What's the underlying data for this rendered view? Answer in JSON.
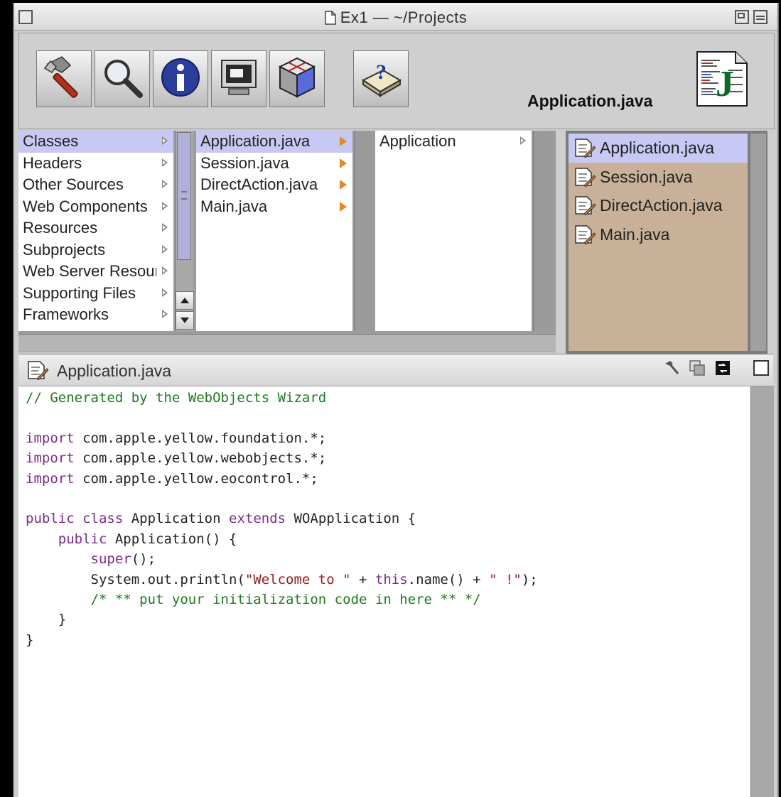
{
  "window": {
    "title": "Ex1 — ~/Projects"
  },
  "toolbar": {
    "buttons": [
      {
        "name": "build-button",
        "icon": "hammer-icon"
      },
      {
        "name": "find-button",
        "icon": "magnifier-icon"
      },
      {
        "name": "inspector-button",
        "icon": "info-icon"
      },
      {
        "name": "launch-button",
        "icon": "monitor-icon"
      },
      {
        "name": "webobjects-builder-button",
        "icon": "cube-icon"
      },
      {
        "name": "help-button",
        "icon": "help-book-icon"
      }
    ],
    "current_file": "Application.java"
  },
  "browser": {
    "column1": [
      {
        "label": "Classes",
        "selected": true
      },
      {
        "label": "Headers"
      },
      {
        "label": "Other Sources"
      },
      {
        "label": "Web Components"
      },
      {
        "label": "Resources"
      },
      {
        "label": "Subprojects"
      },
      {
        "label": "Web Server Resources"
      },
      {
        "label": "Supporting Files"
      },
      {
        "label": "Frameworks"
      }
    ],
    "column2": [
      {
        "label": "Application.java",
        "selected": true
      },
      {
        "label": "Session.java"
      },
      {
        "label": "DirectAction.java"
      },
      {
        "label": "Main.java"
      }
    ],
    "column3": [
      {
        "label": "Application"
      }
    ]
  },
  "file_list": [
    {
      "label": "Application.java",
      "selected": true
    },
    {
      "label": "Session.java"
    },
    {
      "label": "DirectAction.java"
    },
    {
      "label": "Main.java"
    }
  ],
  "editor": {
    "title": "Application.java",
    "code": [
      [
        {
          "t": "// Generated by the WebObjects Wizard",
          "c": "comment"
        }
      ],
      [],
      [
        {
          "t": "import",
          "c": "kw"
        },
        {
          "t": " com.apple.yellow.foundation.*;"
        }
      ],
      [
        {
          "t": "import",
          "c": "kw"
        },
        {
          "t": " com.apple.yellow.webobjects.*;"
        }
      ],
      [
        {
          "t": "import",
          "c": "kw"
        },
        {
          "t": " com.apple.yellow.eocontrol.*;"
        }
      ],
      [],
      [
        {
          "t": "public class",
          "c": "kw"
        },
        {
          "t": " Application "
        },
        {
          "t": "extends",
          "c": "kw"
        },
        {
          "t": " WOApplication {"
        }
      ],
      [
        {
          "t": "    "
        },
        {
          "t": "public",
          "c": "kw"
        },
        {
          "t": " Application() {"
        }
      ],
      [
        {
          "t": "        "
        },
        {
          "t": "super",
          "c": "kw"
        },
        {
          "t": "();"
        }
      ],
      [
        {
          "t": "        System.out.println("
        },
        {
          "t": "\"Welcome to \"",
          "c": "str"
        },
        {
          "t": " + "
        },
        {
          "t": "this",
          "c": "kw"
        },
        {
          "t": ".name() + "
        },
        {
          "t": "\" !\"",
          "c": "str"
        },
        {
          "t": ");"
        }
      ],
      [
        {
          "t": "        "
        },
        {
          "t": "/* ** put your initialization code in here ** */",
          "c": "comment"
        }
      ],
      [
        {
          "t": "    }"
        }
      ],
      [
        {
          "t": "}"
        }
      ]
    ]
  },
  "colors": {
    "selection": "#c8c8f4",
    "arrow_orange": "#e08a20",
    "file_list_bg": "#c9b199",
    "comment": "#1f7a1f",
    "keyword": "#7a2b8a",
    "string": "#9a1a1a"
  }
}
